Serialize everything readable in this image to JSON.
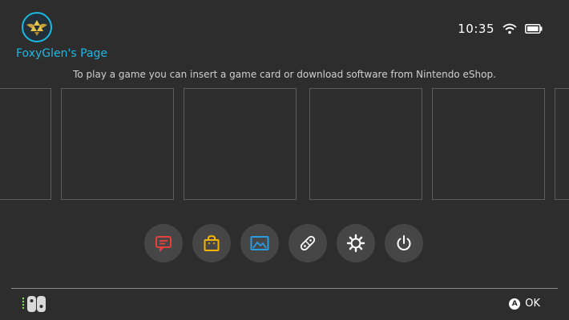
{
  "header": {
    "user_name": "FoxyGlen's Page",
    "time": "10:35",
    "avatar_icon": "triforce-crest-icon"
  },
  "main": {
    "hint": "To play a game you can insert a game card or download software from Nintendo eShop."
  },
  "dock": {
    "items": [
      {
        "name": "news",
        "icon": "news-icon",
        "color": "#e6403c"
      },
      {
        "name": "nintendo-eshop",
        "icon": "shopping-bag-icon",
        "color": "#f5b400"
      },
      {
        "name": "album",
        "icon": "album-icon",
        "color": "#2b9be0"
      },
      {
        "name": "controllers",
        "icon": "controller-icon",
        "color": "#ffffff"
      },
      {
        "name": "system-settings",
        "icon": "gear-icon",
        "color": "#ffffff"
      },
      {
        "name": "sleep-mode",
        "icon": "power-icon",
        "color": "#ffffff"
      }
    ]
  },
  "footer": {
    "ok_button": "A",
    "ok_label": "OK",
    "controller_icon": "joycon-icon"
  }
}
